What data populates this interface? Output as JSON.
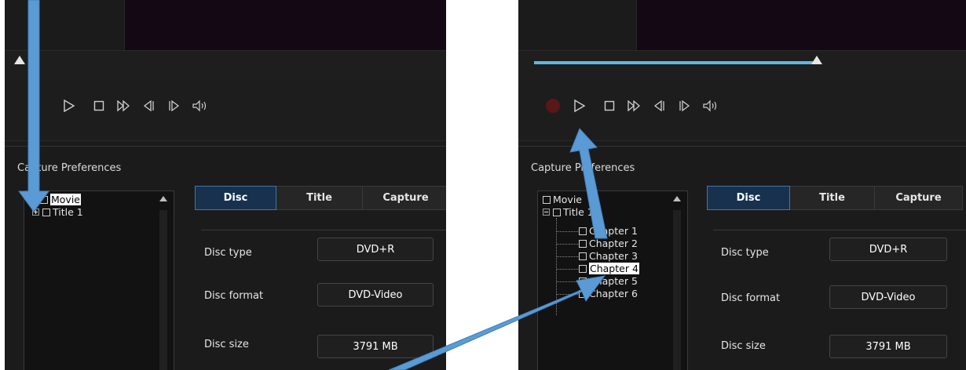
{
  "left": {
    "prefs_title": "Capture Preferences",
    "tree": [
      {
        "label": "Movie"
      },
      {
        "label": "Title 1"
      }
    ],
    "tabs": [
      "Disc",
      "Title",
      "Capture"
    ],
    "rows": [
      {
        "label": "Disc type",
        "value": "DVD+R"
      },
      {
        "label": "Disc format",
        "value": "DVD-Video"
      },
      {
        "label": "Disc size",
        "value": "3791 MB"
      }
    ]
  },
  "right": {
    "prefs_title": "Capture Preferences",
    "tree": [
      {
        "label": "Movie"
      },
      {
        "label": "Title 1"
      },
      {
        "label": "Chapter 1"
      },
      {
        "label": "Chapter 2"
      },
      {
        "label": "Chapter 3"
      },
      {
        "label": "Chapter 4"
      },
      {
        "label": "Chapter 5"
      },
      {
        "label": "Chapter 6"
      }
    ],
    "tabs": [
      "Disc",
      "Title",
      "Capture"
    ],
    "rows": [
      {
        "label": "Disc type",
        "value": "DVD+R"
      },
      {
        "label": "Disc format",
        "value": "DVD-Video"
      },
      {
        "label": "Disc size",
        "value": "3791 MB"
      }
    ],
    "seek_position": 0.68
  },
  "colors": {
    "accent": "#5cb8e6",
    "tab_active": "#17314f",
    "record": "#5a1717",
    "annotation_arrow": "#5b9bd5"
  }
}
